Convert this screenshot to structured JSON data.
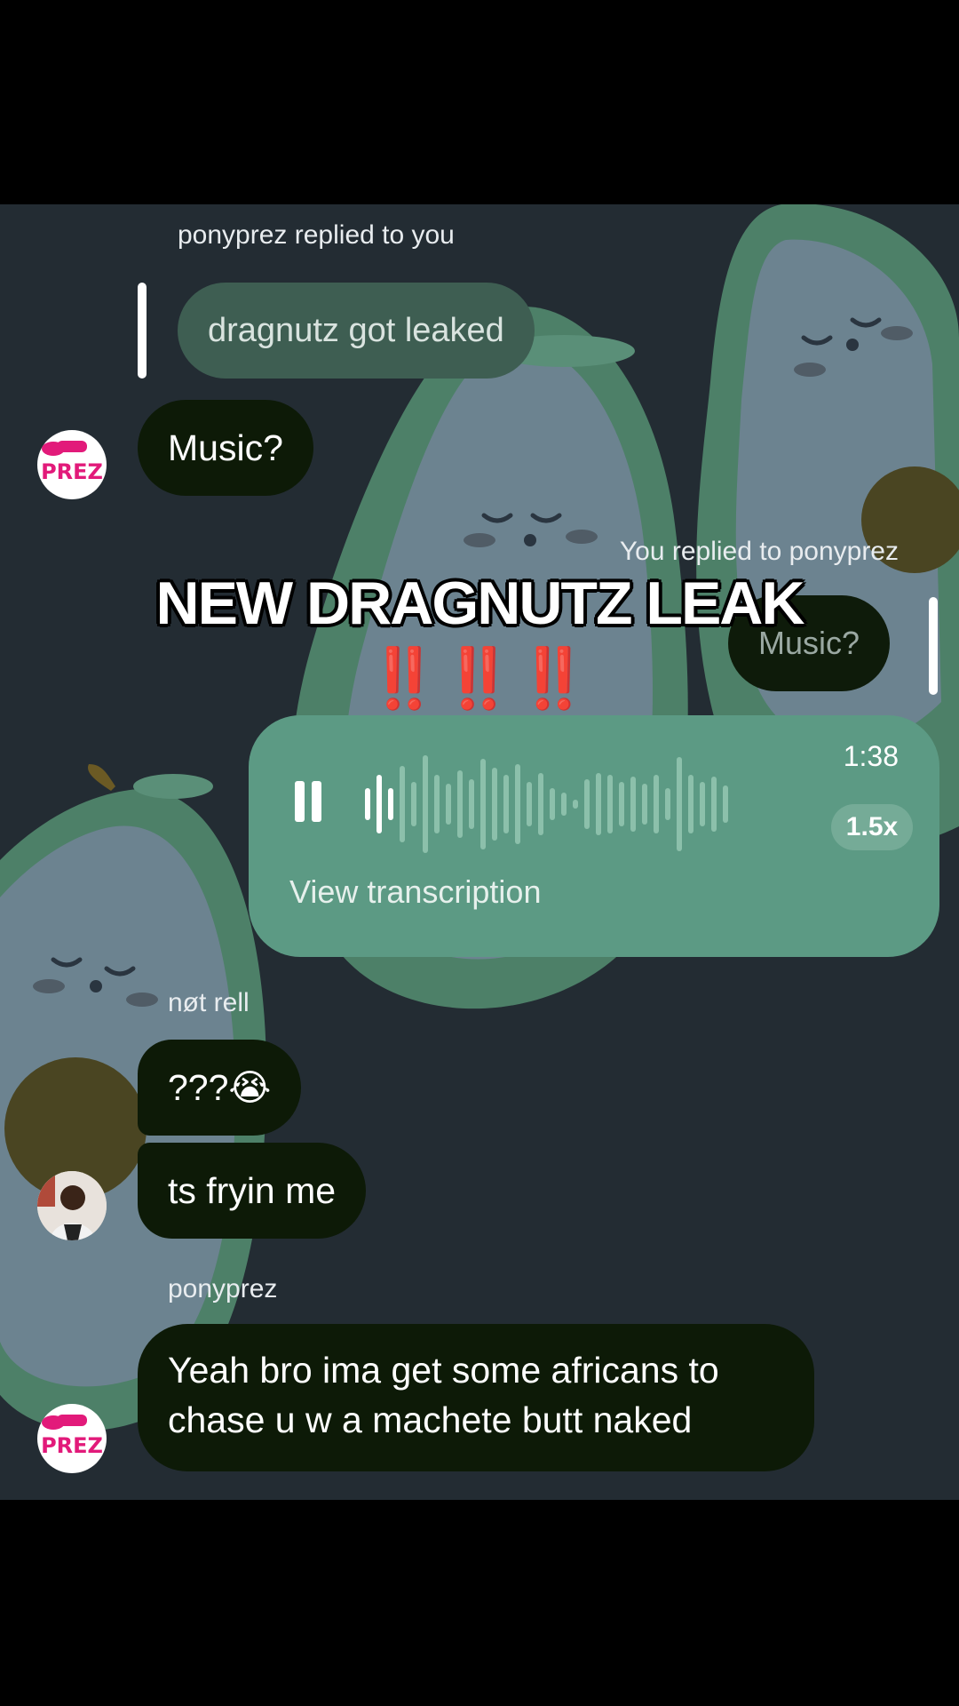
{
  "overlay": {
    "title": "NEW DRAGNUTZ LEAK",
    "marks": "‼️‼️‼️"
  },
  "messages": {
    "reply_notice_1": "ponyprez replied to you",
    "quoted_1": "dragnutz got leaked",
    "msg_music": "Music?",
    "reply_notice_2": "You replied to ponyprez",
    "quoted_2": "Music?",
    "voice": {
      "duration": "1:38",
      "speed": "1.5x",
      "transcription_label": "View transcription",
      "state": "playing"
    },
    "sender_rell": "nøt rell",
    "msg_q": "???😭",
    "msg_fryin": "ts fryin me",
    "sender_ponyprez": "ponyprez",
    "msg_long_line1": "Yeah bro ima get some africans to",
    "msg_long_line2": "chase u w a machete butt naked"
  },
  "avatars": {
    "ponyprez_logo_line1": "my pony",
    "ponyprez_logo_line2": "PREZ"
  },
  "colors": {
    "chat_bg": "#232c33",
    "incoming_bubble": "#0d1a07",
    "voice_bubble": "#5c9a84",
    "overlay_marks": "#e0121a"
  },
  "icons": [
    "pause-icon",
    "waveform-icon"
  ]
}
